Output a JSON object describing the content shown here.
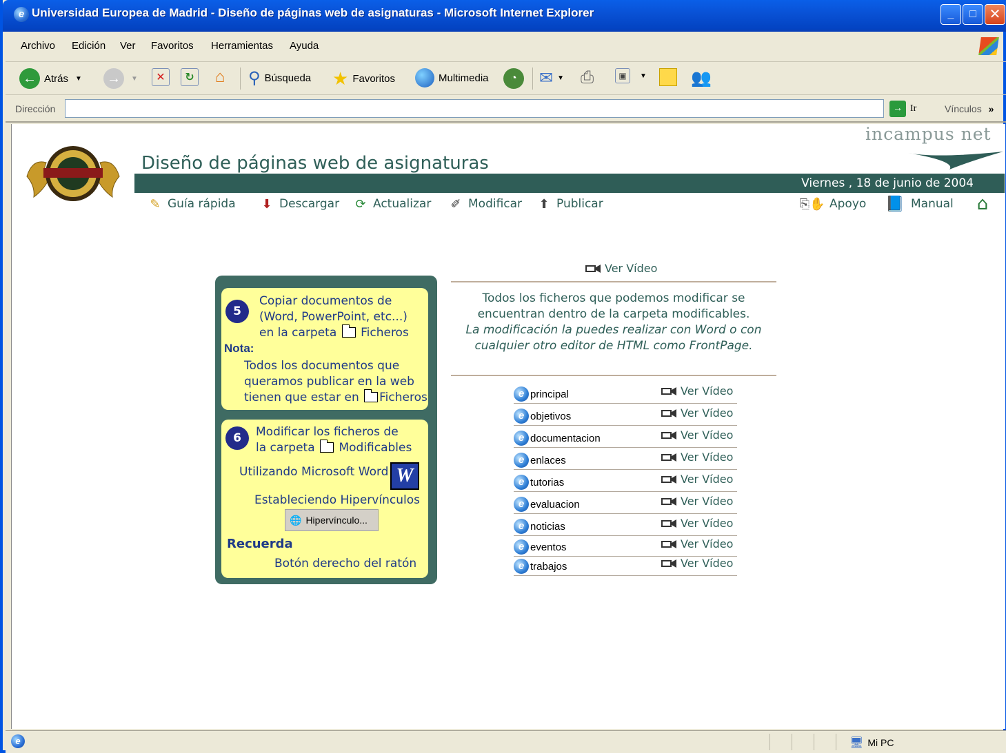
{
  "window": {
    "title": "Universidad Europea de Madrid - Diseño de páginas web de asignaturas - Microsoft Internet Explorer",
    "min": "_",
    "max": "□",
    "close": "✕"
  },
  "menu": [
    "Archivo",
    "Edición",
    "Ver",
    "Favoritos",
    "Herramientas",
    "Ayuda"
  ],
  "toolbar": {
    "back": "Atrás",
    "search": "Búsqueda",
    "favorites": "Favoritos",
    "media": "Multimedia"
  },
  "address": {
    "label": "Dirección",
    "value": "",
    "go": "Ir",
    "links": "Vínculos"
  },
  "page": {
    "title": "Diseño de páginas web de asignaturas",
    "brand": "incampus net",
    "date": "Viernes , 18 de junio de 2004",
    "nav": [
      {
        "label": "Guía rápida",
        "icon": "pencil-icon"
      },
      {
        "label": "Descargar",
        "icon": "download-icon"
      },
      {
        "label": "Actualizar",
        "icon": "refresh-icon"
      },
      {
        "label": "Modificar",
        "icon": "edit-icon"
      },
      {
        "label": "Publicar",
        "icon": "publish-icon"
      }
    ],
    "nav_right": [
      {
        "label": "Apoyo",
        "icon": "support-icon"
      },
      {
        "label": "Manual",
        "icon": "book-icon"
      }
    ]
  },
  "steps": {
    "s5": {
      "num": "5",
      "line1": "Copiar documentos de",
      "line2": "(Word, PowerPoint, etc...)",
      "line3": "en la carpeta",
      "folder": "Ficheros",
      "nota": "Nota:",
      "n1": "Todos los documentos que",
      "n2": "queramos publicar en la web",
      "n3": "tienen que estar en",
      "nfolder": "Ficheros"
    },
    "s6": {
      "num": "6",
      "line1": "Modificar los ficheros de",
      "line2": "la carpeta",
      "folder": "Modificables",
      "word": "Utilizando Microsoft Word",
      "hiper": "Estableciendo Hipervínculos",
      "hiper_btn": "Hipervínculo...",
      "recuerda": "Recuerda",
      "raton": "Botón derecho del ratón"
    }
  },
  "right": {
    "top_video": "Ver Vídeo",
    "desc1": "Todos los ficheros que podemos modificar se encuentran dentro de la carpeta modificables.",
    "desc2": "La modificación la puedes realizar con Word o con cualquier otro editor de HTML como FrontPage.",
    "files": [
      {
        "name": "principal",
        "video": "Ver Vídeo"
      },
      {
        "name": "objetivos",
        "video": "Ver Vídeo"
      },
      {
        "name": "documentacion",
        "video": "Ver Vídeo"
      },
      {
        "name": "enlaces",
        "video": "Ver Vídeo"
      },
      {
        "name": "tutorias",
        "video": "Ver Vídeo"
      },
      {
        "name": "evaluacion",
        "video": "Ver Vídeo"
      },
      {
        "name": "noticias",
        "video": "Ver Vídeo"
      },
      {
        "name": "eventos",
        "video": "Ver Vídeo"
      },
      {
        "name": "trabajos",
        "video": "Ver Vídeo"
      }
    ]
  },
  "status": {
    "zone": "Mi PC"
  }
}
